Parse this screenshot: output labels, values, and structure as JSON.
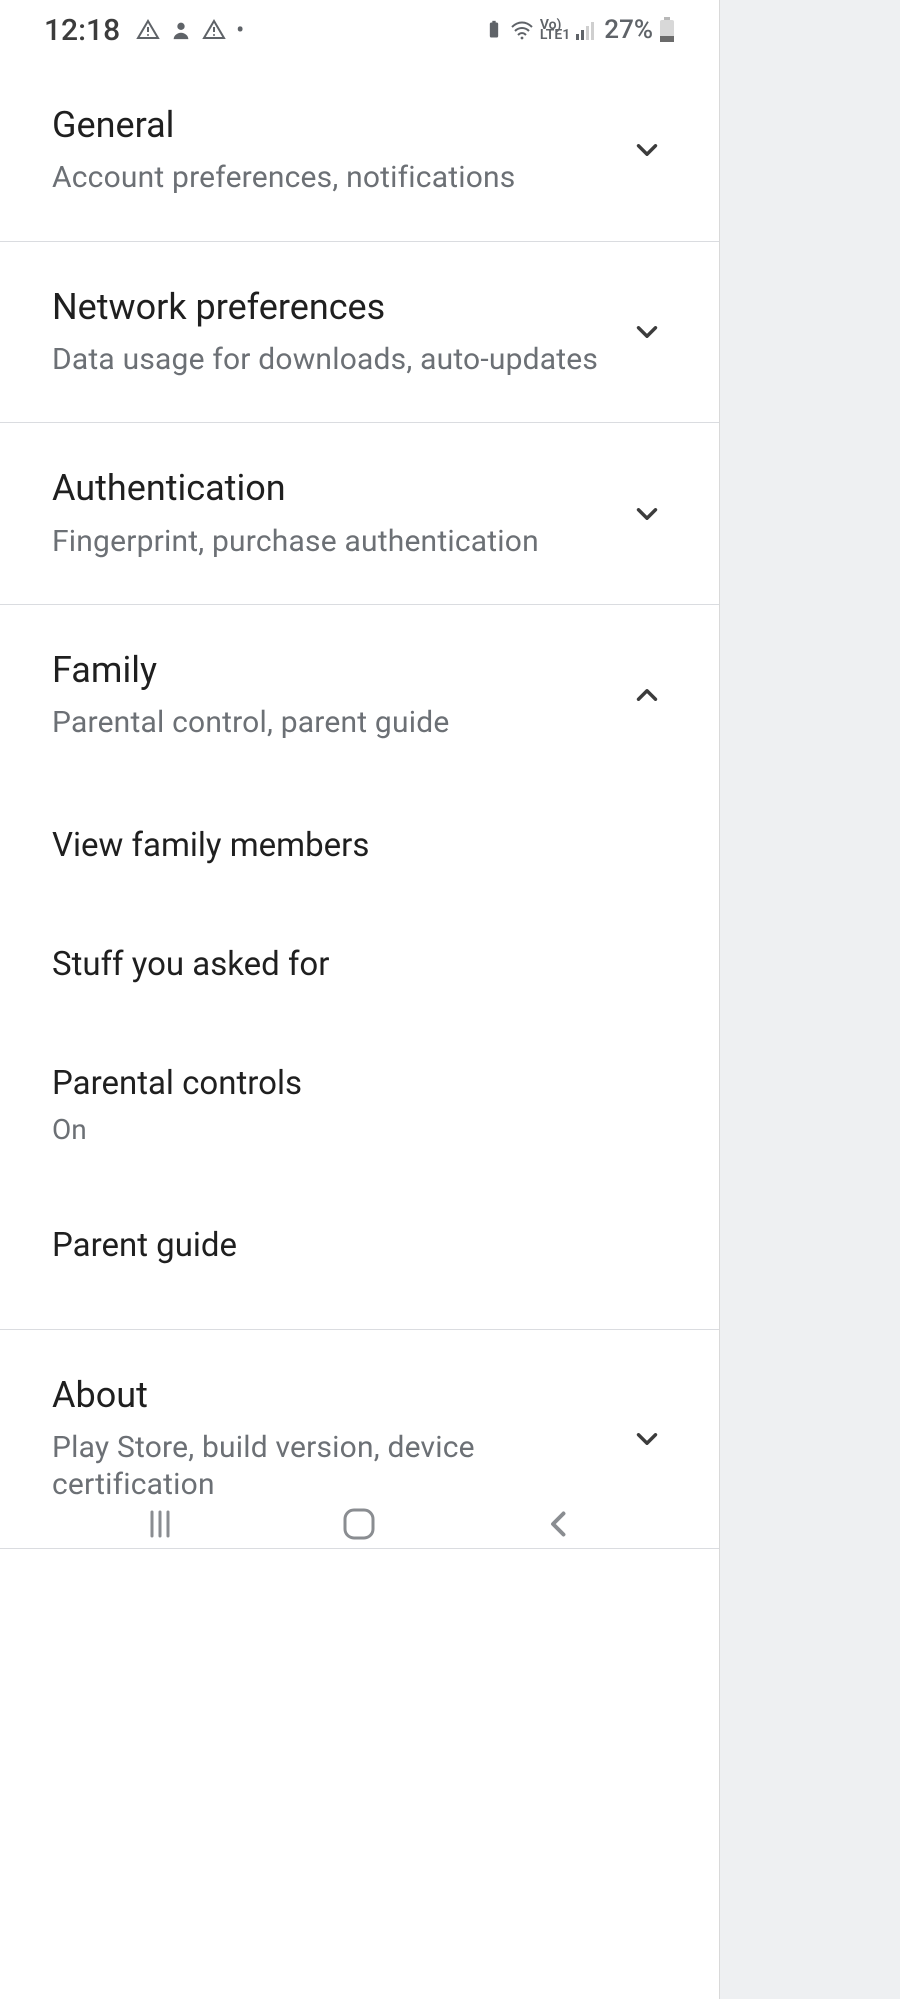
{
  "status": {
    "time": "12:18",
    "battery_pct": "27%",
    "network_label_top": "Vo)",
    "network_label_bottom": "LTE1"
  },
  "sections": {
    "general": {
      "title": "General",
      "subtitle": "Account preferences, notifications",
      "expanded": false
    },
    "network": {
      "title": "Network preferences",
      "subtitle": "Data usage for downloads, auto-updates",
      "expanded": false
    },
    "auth": {
      "title": "Authentication",
      "subtitle": "Fingerprint, purchase authentication",
      "expanded": false
    },
    "family": {
      "title": "Family",
      "subtitle": "Parental control, parent guide",
      "expanded": true,
      "items": [
        {
          "label": "View family members"
        },
        {
          "label": "Stuff you asked for"
        },
        {
          "label": "Parental controls",
          "value": "On"
        },
        {
          "label": "Parent guide"
        }
      ]
    },
    "about": {
      "title": "About",
      "subtitle": "Play Store, build version, device certification",
      "expanded": false
    }
  }
}
